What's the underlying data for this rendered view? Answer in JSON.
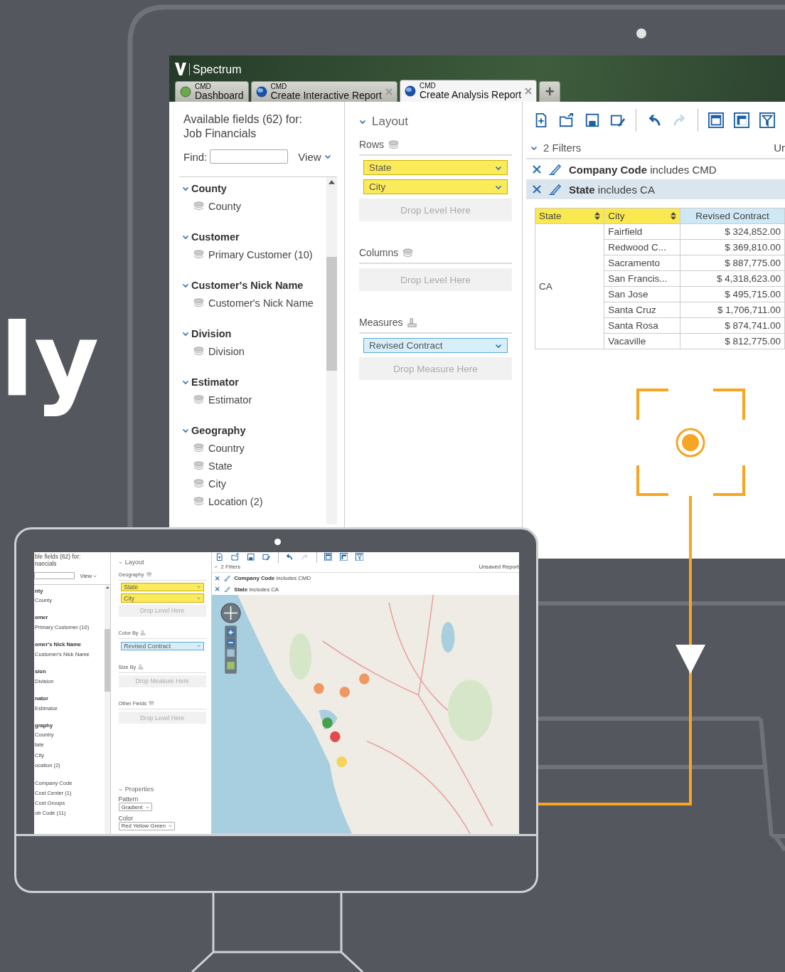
{
  "hero_text": "ly",
  "desktop": {
    "app_name": "Spectrum",
    "tabs": [
      {
        "company": "CMD",
        "label": "Dashboard",
        "kind": "dashboard",
        "selected": false
      },
      {
        "company": "CMD",
        "label": "Create Interactive Report",
        "kind": "report",
        "selected": false
      },
      {
        "company": "CMD",
        "label": "Create Analysis Report",
        "kind": "report",
        "selected": true
      }
    ],
    "new_tab": "+",
    "fields": {
      "title": "Available fields (62) for:",
      "subtitle": "Job Financials",
      "find_label": "Find:",
      "view": "View",
      "groups": [
        {
          "name": "County",
          "expanded": true,
          "children": [
            {
              "name": "County"
            }
          ]
        },
        {
          "name": "Customer",
          "expanded": true,
          "children": [
            {
              "name": "Primary Customer (10)"
            }
          ]
        },
        {
          "name": "Customer's Nick Name",
          "expanded": true,
          "children": [
            {
              "name": "Customer's Nick Name"
            }
          ]
        },
        {
          "name": "Division",
          "expanded": true,
          "children": [
            {
              "name": "Division"
            }
          ]
        },
        {
          "name": "Estimator",
          "expanded": true,
          "children": [
            {
              "name": "Estimator"
            }
          ]
        },
        {
          "name": "Geography",
          "expanded": true,
          "children": [
            {
              "name": "Country"
            },
            {
              "name": "State"
            },
            {
              "name": "City"
            },
            {
              "name": "Location (2)"
            }
          ]
        }
      ]
    },
    "layout": {
      "title": "Layout",
      "sections": [
        {
          "label": "Rows",
          "kind": "level",
          "items": [
            {
              "label": "State",
              "kind": "level"
            },
            {
              "label": "City",
              "kind": "level"
            }
          ],
          "drop": "Drop Level Here"
        },
        {
          "label": "Columns",
          "kind": "level",
          "drop": "Drop Level Here"
        },
        {
          "label": "Measures",
          "kind": "measure",
          "items": [
            {
              "label": "Revised Contract",
              "kind": "measure"
            }
          ],
          "drop": "Drop Measure Here"
        }
      ]
    },
    "report": {
      "toolbar": [
        {
          "kind": "new",
          "disabled": false
        },
        {
          "kind": "open",
          "disabled": false
        },
        {
          "kind": "save",
          "disabled": false
        },
        {
          "kind": "save-as",
          "disabled": false
        },
        {
          "kind": "sep"
        },
        {
          "kind": "undo",
          "disabled": false
        },
        {
          "kind": "redo",
          "disabled": true
        },
        {
          "kind": "sep"
        },
        {
          "kind": "layout-a",
          "disabled": false
        },
        {
          "kind": "layout-b",
          "disabled": false
        },
        {
          "kind": "filter",
          "disabled": false
        }
      ],
      "filter_count": "2 Filters",
      "title": "Ur",
      "filters": [
        {
          "text": "**Company Code** includes CMD",
          "selected": false
        },
        {
          "text": "**State** includes CA",
          "selected": true
        }
      ],
      "table": {
        "columns": [
          "State",
          "City",
          "Revised Contract"
        ],
        "group": "CA",
        "rows": [
          {
            "city": "Fairfield",
            "value": "$ 324,852.00"
          },
          {
            "city": "Redwood C...",
            "value": "$ 369,810.00"
          },
          {
            "city": "Sacramento",
            "value": "$ 887,775.00"
          },
          {
            "city": "San Francis...",
            "value": "$ 4,318,623.00"
          },
          {
            "city": "San Jose",
            "value": "$ 495,715.00"
          },
          {
            "city": "Santa Cruz",
            "value": "$ 1,706,711.00"
          },
          {
            "city": "Santa Rosa",
            "value": "$ 874,741.00"
          },
          {
            "city": "Vacaville",
            "value": "$ 812,775.00"
          }
        ]
      }
    }
  },
  "laptop": {
    "fields": {
      "title": "ble fields (62) for:",
      "subtitle": "nancials",
      "view": "View",
      "groups": [
        {
          "name": "nty",
          "children": [
            {
              "name": "County"
            }
          ]
        },
        {
          "name": "omer",
          "children": [
            {
              "name": "Primary Customer (10)"
            }
          ]
        },
        {
          "name": "omer's Nick Name",
          "children": [
            {
              "name": "Customer's Nick Name"
            }
          ]
        },
        {
          "name": "sion",
          "children": [
            {
              "name": "Division"
            }
          ]
        },
        {
          "name": "nator",
          "children": [
            {
              "name": "Estimator"
            }
          ]
        },
        {
          "name": "graphy",
          "children": [
            {
              "name": "Country"
            },
            {
              "name": "tate"
            },
            {
              "name": "City"
            },
            {
              "name": "ocation (2)"
            }
          ]
        }
      ],
      "more_fields": [
        "Company Code",
        "Cost Center (1)",
        "Cost Groups",
        "ob Code (11)"
      ]
    },
    "layout": {
      "title": "Layout",
      "sections": [
        {
          "label": "Geography",
          "kind": "level",
          "items": [
            {
              "label": "State",
              "kind": "level"
            },
            {
              "label": "City",
              "kind": "level"
            }
          ],
          "drop": "Drop Level Here"
        },
        {
          "label": "Color By",
          "kind": "measure",
          "items": [
            {
              "label": "Revised Contract",
              "kind": "measure"
            }
          ]
        },
        {
          "label": "Size By",
          "kind": "measure",
          "drop": "Drop Measure Here"
        },
        {
          "label": "Other Fields",
          "kind": "level",
          "drop": "Drop Level Here"
        }
      ],
      "properties": {
        "title": "Properties",
        "fields": [
          {
            "label": "Pattern",
            "value": "Gradient"
          },
          {
            "label": "Color",
            "value": "Red Yellow Green"
          }
        ]
      }
    },
    "report": {
      "toolbar": [
        {
          "kind": "new",
          "disabled": false
        },
        {
          "kind": "open",
          "disabled": false
        },
        {
          "kind": "save",
          "disabled": false
        },
        {
          "kind": "save-as",
          "disabled": false
        },
        {
          "kind": "sep"
        },
        {
          "kind": "undo",
          "disabled": false
        },
        {
          "kind": "redo",
          "disabled": true
        },
        {
          "kind": "sep"
        },
        {
          "kind": "layout-a",
          "disabled": false
        },
        {
          "kind": "layout-b",
          "disabled": false
        },
        {
          "kind": "filter",
          "disabled": false
        }
      ],
      "filter_count": "2 Filters",
      "title": "Unsaved Report",
      "filters": [
        {
          "text": "**Company Code** includes CMD",
          "selected": false
        },
        {
          "text": "**State** includes CA",
          "selected": false
        }
      ]
    }
  }
}
